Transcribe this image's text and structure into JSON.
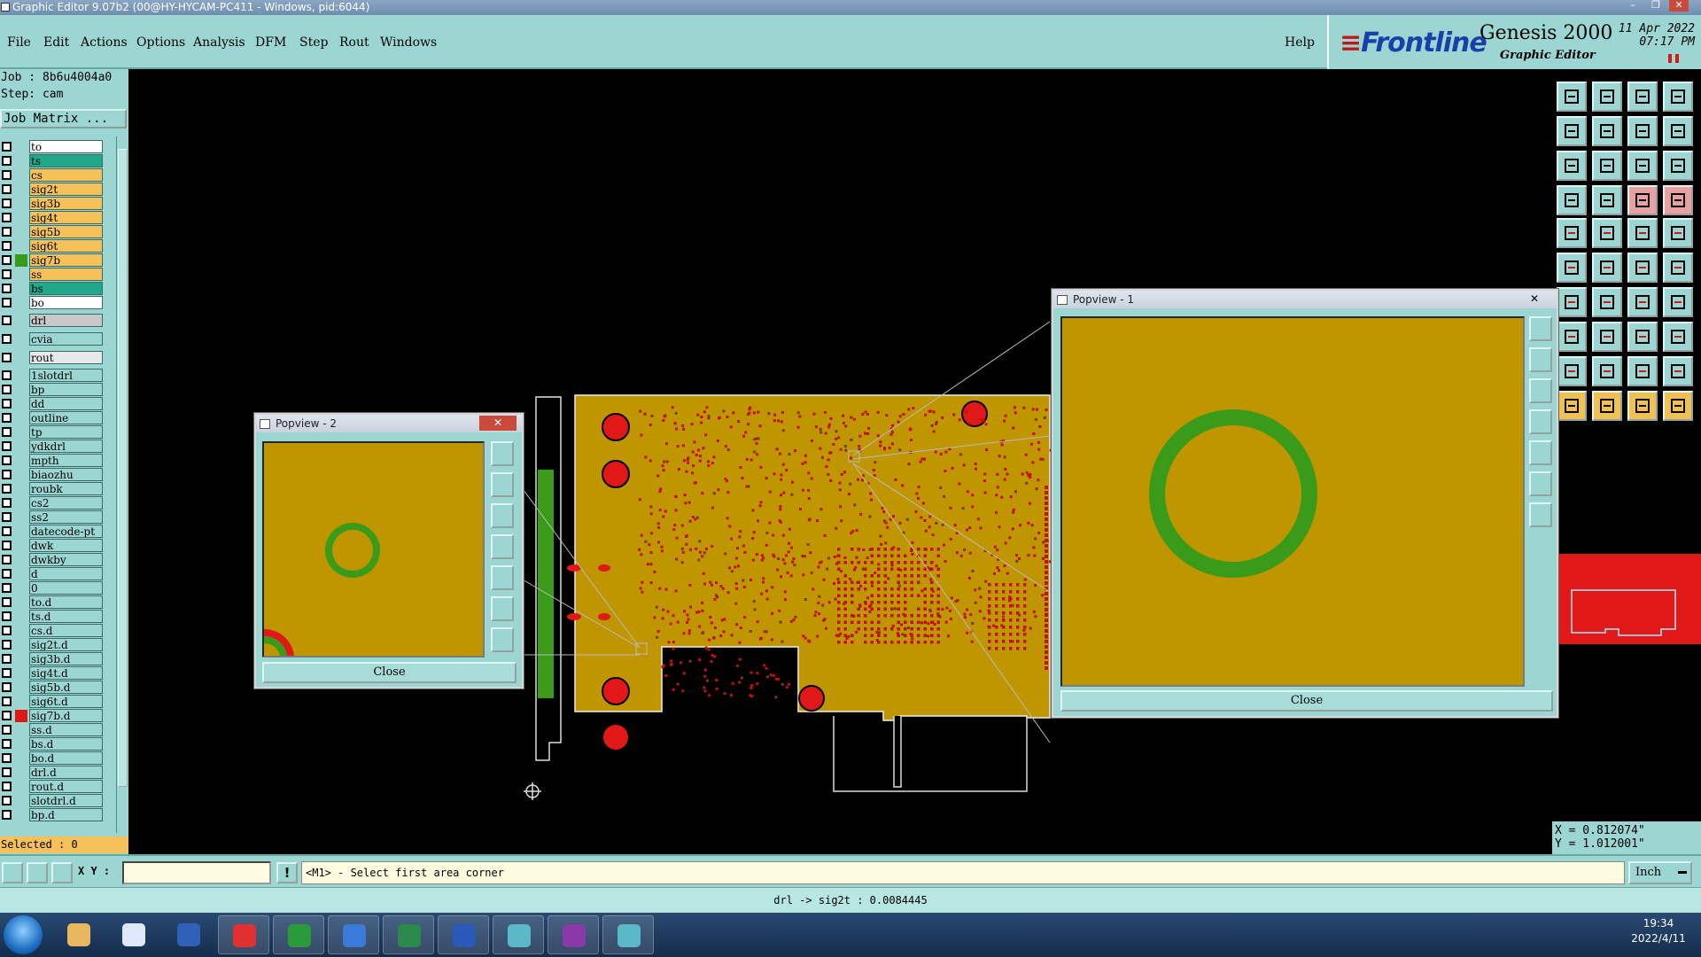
{
  "window": {
    "title": "Graphic Editor 9.07b2 (00@HY-HYCAM-PC411 - Windows, pid:6044)"
  },
  "menubar": {
    "items": [
      "File",
      "Edit",
      "Actions",
      "Options",
      "Analysis",
      "DFM",
      "Step",
      "Rout",
      "Windows"
    ],
    "help": "Help"
  },
  "brand": {
    "logo": "Frontline",
    "product": "Genesis 2000",
    "subtitle": "Graphic Editor",
    "date": "11 Apr 2022",
    "time": "07:17 PM"
  },
  "leftpanel": {
    "job": "Job : 8b6u4004a0",
    "step": "Step: cam",
    "job_matrix_label": "Job Matrix ...",
    "selected": "Selected : 0"
  },
  "layers": [
    {
      "name": "to",
      "bg": "#ffffff",
      "swatch": ""
    },
    {
      "name": "ts",
      "bg": "#20a888",
      "swatch": ""
    },
    {
      "name": "cs",
      "bg": "#f7c15a",
      "swatch": ""
    },
    {
      "name": "sig2t",
      "bg": "#f7c15a",
      "swatch": ""
    },
    {
      "name": "sig3b",
      "bg": "#f7c15a",
      "swatch": ""
    },
    {
      "name": "sig4t",
      "bg": "#f7c15a",
      "swatch": ""
    },
    {
      "name": "sig5b",
      "bg": "#f7c15a",
      "swatch": ""
    },
    {
      "name": "sig6t",
      "bg": "#f7c15a",
      "swatch": ""
    },
    {
      "name": "sig7b",
      "bg": "#f7c15a",
      "swatch": "#3a9a1a"
    },
    {
      "name": "ss",
      "bg": "#f7c15a",
      "swatch": ""
    },
    {
      "name": "bs",
      "bg": "#20a888",
      "swatch": ""
    },
    {
      "name": "bo",
      "bg": "#ffffff",
      "swatch": ""
    },
    {
      "name": "drl",
      "bg": "#c8c8c8",
      "swatch": ""
    },
    {
      "name": "cvia",
      "bg": "#9cd6d2",
      "swatch": ""
    },
    {
      "name": "rout",
      "bg": "#e8e8e8",
      "swatch": ""
    },
    {
      "name": "1slotdrl",
      "bg": "#9cd6d2",
      "swatch": ""
    },
    {
      "name": "bp",
      "bg": "#9cd6d2",
      "swatch": ""
    },
    {
      "name": "dd",
      "bg": "#9cd6d2",
      "swatch": ""
    },
    {
      "name": "outline",
      "bg": "#9cd6d2",
      "swatch": ""
    },
    {
      "name": "tp",
      "bg": "#9cd6d2",
      "swatch": ""
    },
    {
      "name": "ydkdrl",
      "bg": "#9cd6d2",
      "swatch": ""
    },
    {
      "name": "mpth",
      "bg": "#9cd6d2",
      "swatch": ""
    },
    {
      "name": "biaozhu",
      "bg": "#9cd6d2",
      "swatch": ""
    },
    {
      "name": "roubk",
      "bg": "#9cd6d2",
      "swatch": ""
    },
    {
      "name": "cs2",
      "bg": "#9cd6d2",
      "swatch": ""
    },
    {
      "name": "ss2",
      "bg": "#9cd6d2",
      "swatch": ""
    },
    {
      "name": "datecode-pt",
      "bg": "#9cd6d2",
      "swatch": ""
    },
    {
      "name": "dwk",
      "bg": "#9cd6d2",
      "swatch": ""
    },
    {
      "name": "dwkby",
      "bg": "#9cd6d2",
      "swatch": ""
    },
    {
      "name": "d",
      "bg": "#9cd6d2",
      "swatch": ""
    },
    {
      "name": "0",
      "bg": "#9cd6d2",
      "swatch": ""
    },
    {
      "name": "to.d",
      "bg": "#9cd6d2",
      "swatch": ""
    },
    {
      "name": "ts.d",
      "bg": "#9cd6d2",
      "swatch": ""
    },
    {
      "name": "cs.d",
      "bg": "#9cd6d2",
      "swatch": ""
    },
    {
      "name": "sig2t.d",
      "bg": "#9cd6d2",
      "swatch": ""
    },
    {
      "name": "sig3b.d",
      "bg": "#9cd6d2",
      "swatch": ""
    },
    {
      "name": "sig4t.d",
      "bg": "#9cd6d2",
      "swatch": ""
    },
    {
      "name": "sig5b.d",
      "bg": "#9cd6d2",
      "swatch": ""
    },
    {
      "name": "sig6t.d",
      "bg": "#9cd6d2",
      "swatch": ""
    },
    {
      "name": "sig7b.d",
      "bg": "#9cd6d2",
      "swatch": "#e01818"
    },
    {
      "name": "ss.d",
      "bg": "#9cd6d2",
      "swatch": ""
    },
    {
      "name": "bs.d",
      "bg": "#9cd6d2",
      "swatch": ""
    },
    {
      "name": "bo.d",
      "bg": "#9cd6d2",
      "swatch": ""
    },
    {
      "name": "drl.d",
      "bg": "#9cd6d2",
      "swatch": ""
    },
    {
      "name": "rout.d",
      "bg": "#9cd6d2",
      "swatch": ""
    },
    {
      "name": "slotdrl.d",
      "bg": "#9cd6d2",
      "swatch": ""
    },
    {
      "name": "bp.d",
      "bg": "#9cd6d2",
      "swatch": ""
    }
  ],
  "popview1": {
    "title": "Popview - 1",
    "close_label": "Close"
  },
  "popview2": {
    "title": "Popview - 2",
    "close_label": "Close"
  },
  "coords": {
    "x": "X = 0.812074\"",
    "y": "Y = 1.012001\""
  },
  "cmdbar": {
    "xy_label": "X Y :",
    "xy_value": "",
    "prompt": "<M1> - Select first area corner",
    "units": "Inch"
  },
  "status": "drl -> sig2t : 0.0084445",
  "taskbar": {
    "time": "19:34",
    "date": "2022/4/11"
  },
  "colors": {
    "panel": "#9cd6d2",
    "board": "#bf9600",
    "pad": "#e01818",
    "fiducial": "#3a9a1a"
  }
}
